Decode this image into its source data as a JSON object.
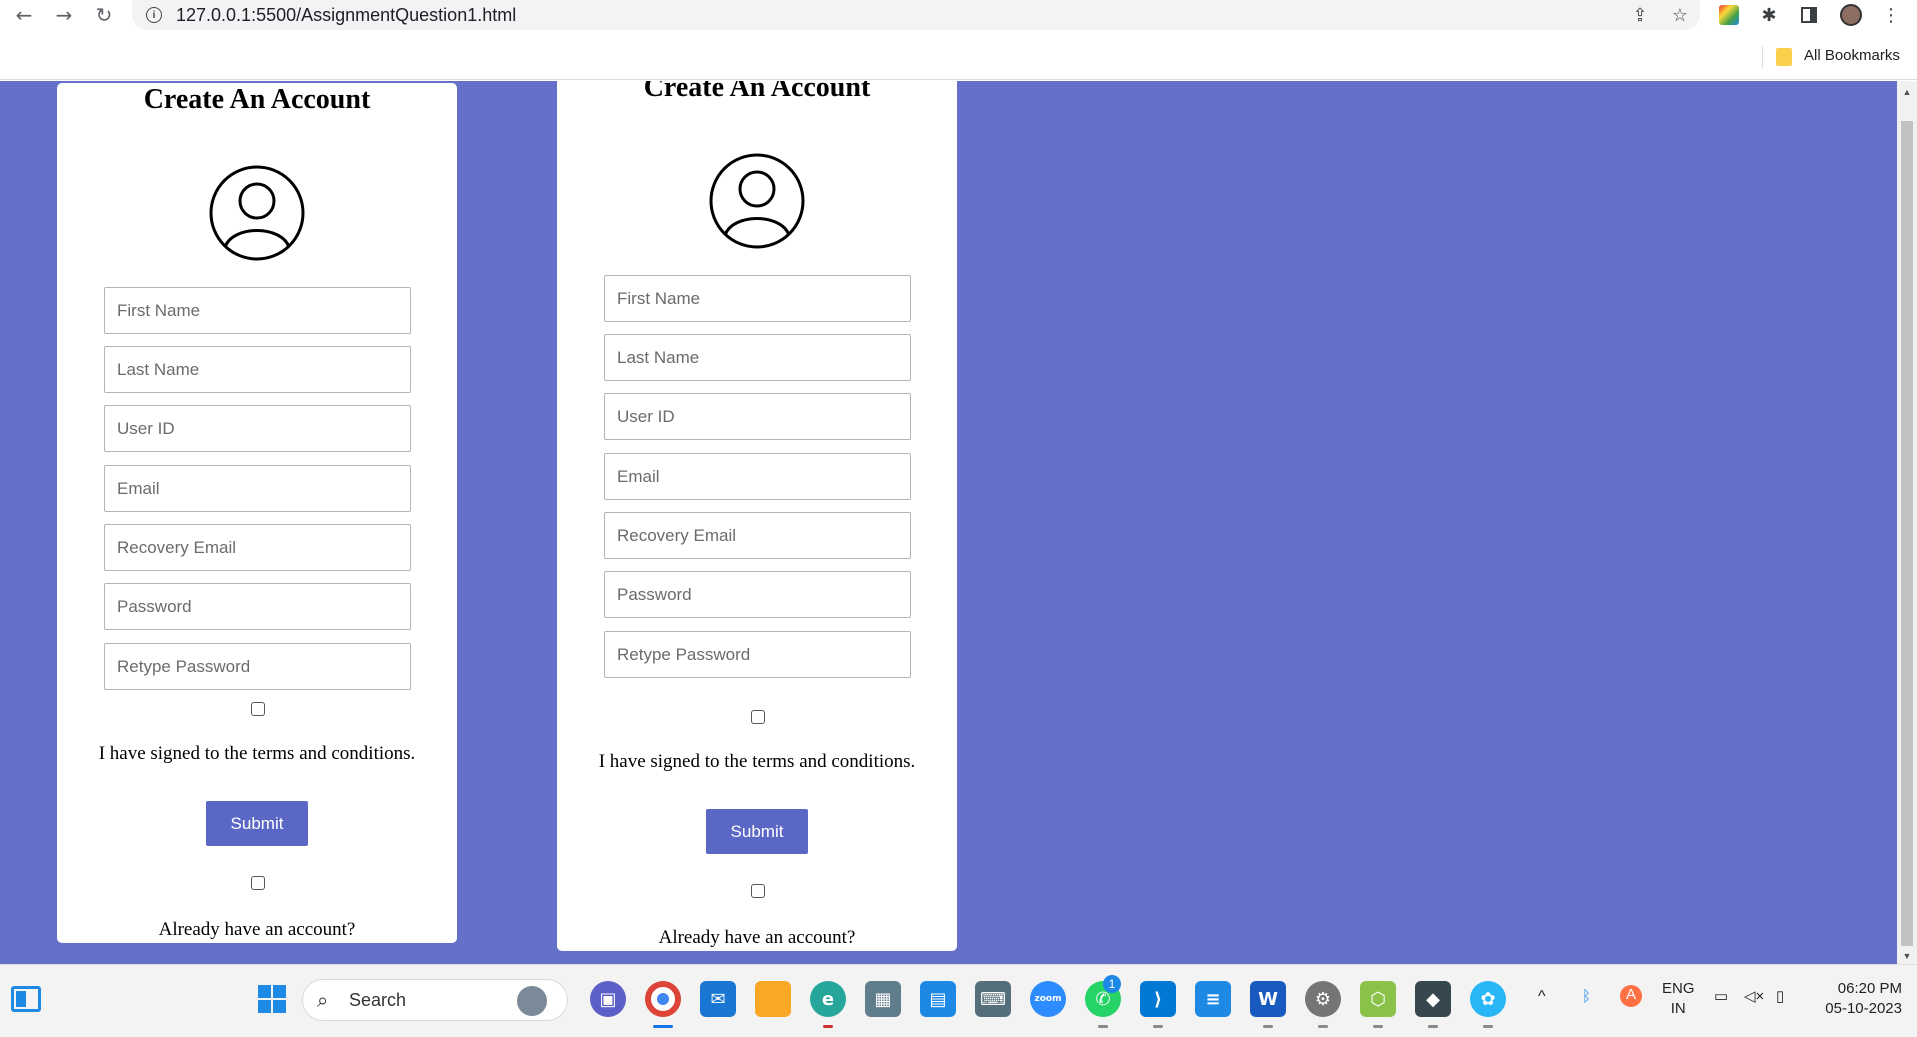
{
  "browser": {
    "url": "127.0.0.1:5500/AssignmentQuestion1.html",
    "bookmarks_label": "All Bookmarks"
  },
  "forms": [
    {
      "title": "Create An Account",
      "fields": {
        "first_name": "First Name",
        "last_name": "Last Name",
        "user_id": "User ID",
        "email": "Email",
        "recovery_email": "Recovery Email",
        "password": "Password",
        "retype_password": "Retype Password"
      },
      "terms": "I have signed to the terms and conditions.",
      "submit": "Submit",
      "already": "Already have an account?"
    },
    {
      "title": "Create An Account",
      "fields": {
        "first_name": "First Name",
        "last_name": "Last Name",
        "user_id": "User ID",
        "email": "Email",
        "recovery_email": "Recovery Email",
        "password": "Password",
        "retype_password": "Retype Password"
      },
      "terms": "I have signed to the terms and conditions.",
      "submit": "Submit",
      "already": "Already have an account?"
    }
  ],
  "colors": {
    "page_bg": "#6570c9",
    "button": "#5a67c4"
  },
  "taskbar": {
    "search_label": "Search",
    "whatsapp_badge": "1",
    "language": "ENG",
    "region": "IN",
    "time": "06:20 PM",
    "date": "05-10-2023",
    "zoom_label": "zoom"
  }
}
